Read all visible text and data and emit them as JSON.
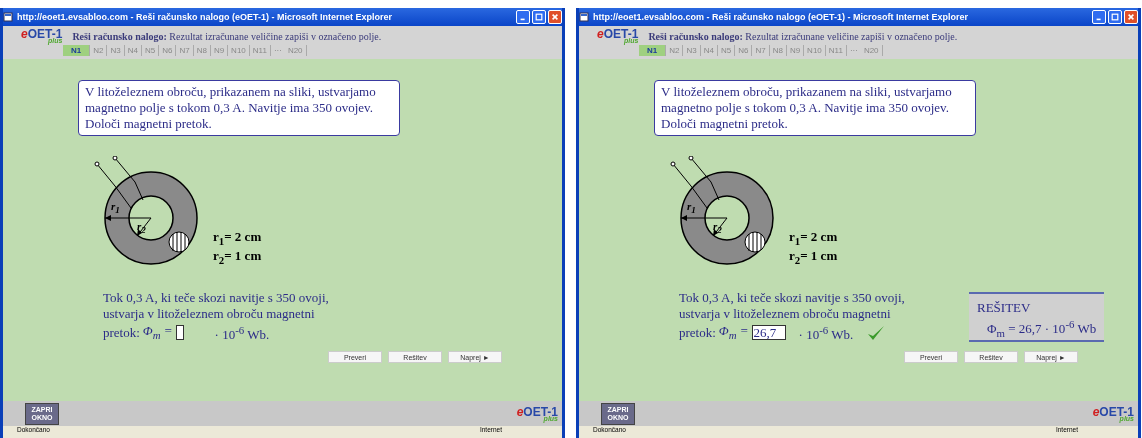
{
  "windows": [
    {
      "title": "http://eoet1.evsabloo.com - Reši računsko nalogo (eOET-1) - Microsoft Internet Explorer",
      "logo": {
        "e": "e",
        "main": "OET-1",
        "sub": "plus"
      },
      "instruction_bold": "Reši računsko nalogo:",
      "instruction": "Rezultat izračunane veličine zapiši v označeno polje.",
      "tabs": [
        {
          "label": "N1",
          "kind": "tab",
          "selected": true
        },
        {
          "label": "N2",
          "kind": "tab",
          "selected": false
        },
        {
          "label": "N3",
          "kind": "tab",
          "selected": false
        },
        {
          "label": "N4",
          "kind": "tab",
          "selected": false
        },
        {
          "label": "N5",
          "kind": "tab",
          "selected": false
        },
        {
          "label": "N6",
          "kind": "tab",
          "selected": false
        },
        {
          "label": "N7",
          "kind": "tab",
          "selected": false
        },
        {
          "label": "N8",
          "kind": "tab",
          "selected": false
        },
        {
          "label": "N9",
          "kind": "tab",
          "selected": false
        },
        {
          "label": "N10",
          "kind": "tab",
          "selected": false
        },
        {
          "label": "N11",
          "kind": "tab",
          "selected": false
        },
        {
          "label": "···",
          "kind": "gap"
        },
        {
          "label": "N20",
          "kind": "tab",
          "selected": false
        }
      ],
      "problem": "V litoželeznem obroču, prikazanem na sliki, ustvarjamo magnetno polje s tokom 0,3 A. Navitje ima 350 ovojev. Določi magnetni pretok.",
      "diagram_labels": [
        "r$_{1}$",
        "r$_{2}$"
      ],
      "given": [
        "r$_{1}$= 2 cm",
        "r$_{2}$= 1 cm"
      ],
      "answer_text": "Tok 0,3 A, ki teče skozi navitje s 350 ovoji, ustvarja v litoželeznem obroču magnetni",
      "answer_label": "pretok:",
      "answer_prefix": "Φ$_{m}$ =",
      "answer_suffix": "· 10$^{-6}$ Wb.",
      "buttons": [
        "Preveri",
        "Rešitev",
        "Naprej ►"
      ],
      "close_button": "ZAPRI OKNO",
      "footer_logo": {
        "e": "e",
        "main": "OET-1",
        "sub": "plus"
      },
      "status": "Dokončano",
      "zone": "Internet"
    },
    {
      "title": "http://eoet1.evsabloo.com - Reši računsko nalogo (eOET-1) - Microsoft Internet Explorer",
      "logo": {
        "e": "e",
        "main": "OET-1",
        "sub": "plus"
      },
      "instruction_bold": "Reši računsko nalogo:",
      "instruction": "Rezultat izračunane veličine zapiši v označeno polje.",
      "tabs": [
        {
          "label": "N1",
          "kind": "tab",
          "selected": true
        },
        {
          "label": "N2",
          "kind": "tab",
          "selected": false
        },
        {
          "label": "N3",
          "kind": "tab",
          "selected": false
        },
        {
          "label": "N4",
          "kind": "tab",
          "selected": false
        },
        {
          "label": "N5",
          "kind": "tab",
          "selected": false
        },
        {
          "label": "N6",
          "kind": "tab",
          "selected": false
        },
        {
          "label": "N7",
          "kind": "tab",
          "selected": false
        },
        {
          "label": "N8",
          "kind": "tab",
          "selected": false
        },
        {
          "label": "N9",
          "kind": "tab",
          "selected": false
        },
        {
          "label": "N10",
          "kind": "tab",
          "selected": false
        },
        {
          "label": "N11",
          "kind": "tab",
          "selected": false
        },
        {
          "label": "···",
          "kind": "gap"
        },
        {
          "label": "N20",
          "kind": "tab",
          "selected": false
        }
      ],
      "problem": "V litoželeznem obroču, prikazanem na sliki, ustvarjamo magnetno polje s tokom 0,3 A. Navitje ima 350 ovojev. Določi magnetni pretok.",
      "diagram_labels": [
        "r$_{1}$",
        "r$_{2}$"
      ],
      "given": [
        "r$_{1}$= 2 cm",
        "r$_{2}$= 1 cm"
      ],
      "answer_text": "Tok 0,3 A, ki teče skozi navitje s 350 ovoji, ustvarja v litoželeznem obroču magnetni",
      "answer_label": "pretok:",
      "answer_prefix": "Φ$_{m}$ =",
      "answer_field": {
        "value": "26,7"
      },
      "answer_suffix": "· 10$^{-6}$ Wb.",
      "correct": true,
      "solution": {
        "heading": "REŠITEV",
        "formula": "Φ$_{m}$ = 26,7 · 10$^{-6}$ Wb"
      },
      "buttons": [
        "Preveri",
        "Rešitev",
        "Naprej ►"
      ],
      "close_button": "ZAPRI OKNO",
      "footer_logo": {
        "e": "e",
        "main": "OET-1",
        "sub": "plus"
      },
      "status": "Dokončano",
      "zone": "Internet"
    }
  ]
}
